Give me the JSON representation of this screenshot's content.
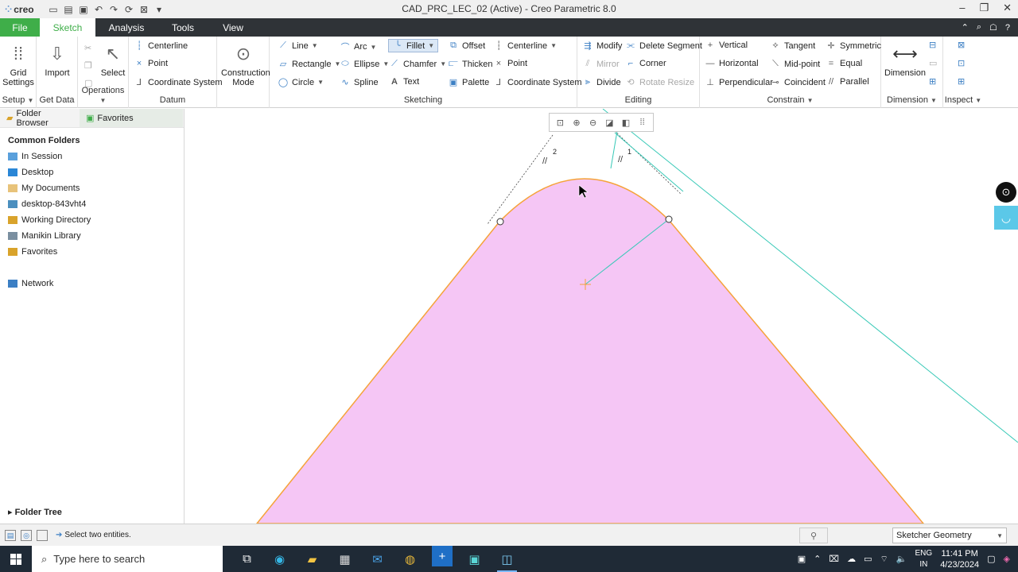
{
  "app": {
    "logo": "creo",
    "window_title": "CAD_PRC_LEC_02 (Active) - Creo Parametric 8.0"
  },
  "tabs": [
    "File",
    "Sketch",
    "Analysis",
    "Tools",
    "View"
  ],
  "ribbon": {
    "setup": {
      "grid_settings": "Grid Settings",
      "label": "Setup"
    },
    "get_data": {
      "import": "Import",
      "label": "Get Data"
    },
    "operations": {
      "select": "Select",
      "label": "Operations"
    },
    "datum": {
      "centerline": "Centerline",
      "point": "Point",
      "coordinate_system": "Coordinate System",
      "label": "Datum"
    },
    "construction": {
      "mode": "Construction Mode"
    },
    "sketching": {
      "line": "Line",
      "rectangle": "Rectangle",
      "circle": "Circle",
      "arc": "Arc",
      "ellipse": "Ellipse",
      "spline": "Spline",
      "fillet": "Fillet",
      "chamfer": "Chamfer",
      "text": "Text",
      "offset": "Offset",
      "thicken": "Thicken",
      "palette": "Palette",
      "centerline": "Centerline",
      "point": "Point",
      "coordinate_system": "Coordinate System",
      "label": "Sketching"
    },
    "editing": {
      "modify": "Modify",
      "delete_segment": "Delete Segment",
      "mirror": "Mirror",
      "corner": "Corner",
      "divide": "Divide",
      "rotate_resize": "Rotate Resize",
      "label": "Editing"
    },
    "constrain": {
      "vertical": "Vertical",
      "tangent": "Tangent",
      "symmetric": "Symmetric",
      "horizontal": "Horizontal",
      "mid_point": "Mid-point",
      "equal": "Equal",
      "perpendicular": "Perpendicular",
      "coincident": "Coincident",
      "parallel": "Parallel",
      "label": "Constrain"
    },
    "dimension": {
      "dimension": "Dimension",
      "label": "Dimension"
    },
    "inspect": {
      "label": "Inspect"
    }
  },
  "left_panel": {
    "tabs": [
      "Folder Browser",
      "Favorites"
    ],
    "section_title": "Common Folders",
    "items": [
      "In Session",
      "Desktop",
      "My Documents",
      "desktop-843vht4",
      "Working Directory",
      "Manikin Library",
      "Favorites"
    ],
    "network": "Network",
    "folder_tree": "Folder Tree"
  },
  "canvas": {
    "constraint_label_1": "1",
    "constraint_label_2": "2",
    "shape_fill": "#f5c6f5",
    "shape_stroke": "#f5a33a"
  },
  "status": {
    "message": "Select two entities.",
    "filter": "Sketcher Geometry"
  },
  "taskbar": {
    "search_placeholder": "Type here to search",
    "lang_1": "ENG",
    "lang_2": "IN",
    "time": "11:41 PM",
    "date": "4/23/2024"
  }
}
